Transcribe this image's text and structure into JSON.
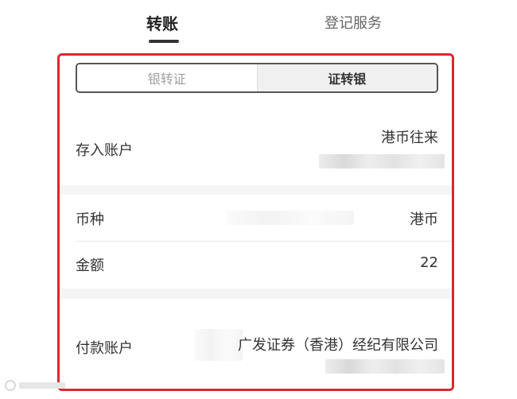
{
  "tabs": {
    "transfer_label": "转账",
    "services_label": "登记服务"
  },
  "segment": {
    "bank_to_securities": "银转证",
    "securities_to_bank": "证转银"
  },
  "deposit_account": {
    "label": "存入账户",
    "value": "港币往来"
  },
  "currency": {
    "label": "币种",
    "value": "港币"
  },
  "amount": {
    "label": "金额",
    "value": "22"
  },
  "payment_account": {
    "label": "付款账户",
    "value": "广发证券（香港）经纪有限公司"
  },
  "colors": {
    "highlight_border": "#d9282f"
  }
}
